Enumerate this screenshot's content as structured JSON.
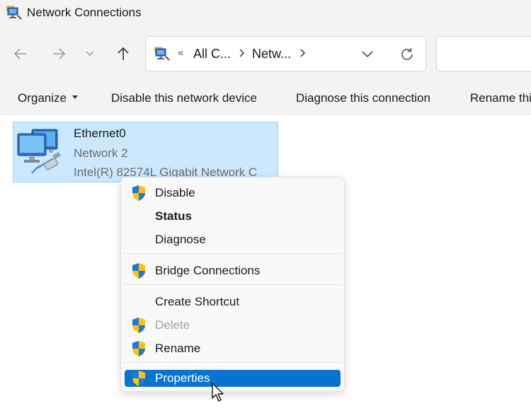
{
  "window": {
    "title": "Network Connections",
    "icon": "network-connections-icon"
  },
  "nav": {
    "back_icon": "back-arrow-icon",
    "forward_icon": "forward-arrow-icon",
    "recent_icon": "chevron-down-icon",
    "up_icon": "up-arrow-icon",
    "address": {
      "overflow": "«",
      "crumbs": [
        "All C...",
        "Netw..."
      ],
      "dropdown_icon": "chevron-down-icon",
      "refresh_icon": "refresh-icon"
    }
  },
  "commands": {
    "organize": "Organize",
    "disable": "Disable this network device",
    "diagnose": "Diagnose this connection",
    "rename": "Rename thi"
  },
  "adapter": {
    "name": "Ethernet0",
    "network": "Network 2",
    "device": "Intel(R) 82574L Gigabit Network C"
  },
  "context_menu": {
    "items": [
      {
        "label": "Disable",
        "shield": true
      },
      {
        "label": "Status",
        "bold": true
      },
      {
        "label": "Diagnose"
      },
      {
        "label": "Bridge Connections",
        "shield": true
      },
      {
        "label": "Create Shortcut"
      },
      {
        "label": "Delete",
        "shield": true,
        "disabled": true
      },
      {
        "label": "Rename",
        "shield": true
      },
      {
        "label": "Properties",
        "shield": true,
        "highlighted": true
      }
    ],
    "highlight_color": "#0a72cf"
  },
  "colors": {
    "selection_bg": "#cce8ff",
    "selection_border": "#99d1ff",
    "shield_blue": "#1e78d7",
    "shield_yellow": "#ffc20e"
  }
}
